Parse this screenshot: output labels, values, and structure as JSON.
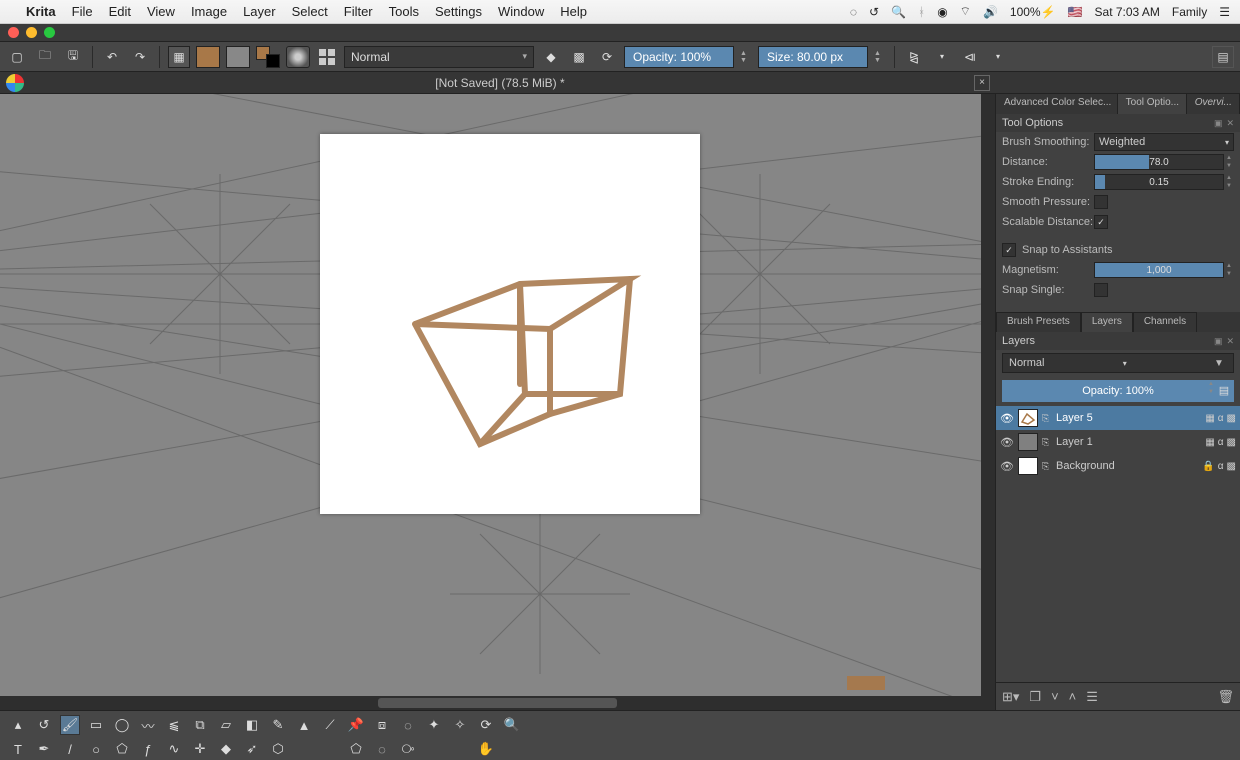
{
  "menubar": {
    "app": "Krita",
    "items": [
      "File",
      "Edit",
      "View",
      "Image",
      "Layer",
      "Select",
      "Filter",
      "Tools",
      "Settings",
      "Window",
      "Help"
    ],
    "battery": "100%",
    "time": "Sat 7:03 AM",
    "user": "Family"
  },
  "toolbar": {
    "blend_mode": "Normal",
    "opacity_label": "Opacity: 100%",
    "size_label": "Size: 80.00 px"
  },
  "document": {
    "title": "[Not Saved]   (78.5 MiB) *"
  },
  "right_tabs": {
    "t1": "Advanced Color Selec...",
    "t2": "Tool Optio...",
    "t3": "Overvi..."
  },
  "tool_options": {
    "header": "Tool Options",
    "smoothing_label": "Brush Smoothing:",
    "smoothing_value": "Weighted",
    "distance_label": "Distance:",
    "distance_value": "78.0",
    "stroke_label": "Stroke Ending:",
    "stroke_value": "0.15",
    "smooth_pressure": "Smooth Pressure:",
    "scalable_distance": "Scalable Distance:",
    "snap_assist": "Snap to Assistants",
    "magnetism_label": "Magnetism:",
    "magnetism_value": "1,000",
    "snap_single": "Snap Single:"
  },
  "layer_tabs": {
    "t1": "Brush Presets",
    "t2": "Layers",
    "t3": "Channels"
  },
  "layers_panel": {
    "header": "Layers",
    "blend": "Normal",
    "opacity": "Opacity:  100%",
    "rows": [
      {
        "name": "Layer 5",
        "selected": true,
        "thumb": "sketch"
      },
      {
        "name": "Layer 1",
        "selected": false,
        "thumb": "grey"
      },
      {
        "name": "Background",
        "selected": false,
        "thumb": "white",
        "locked": true
      }
    ]
  },
  "colors": {
    "brown": "#a87848"
  }
}
